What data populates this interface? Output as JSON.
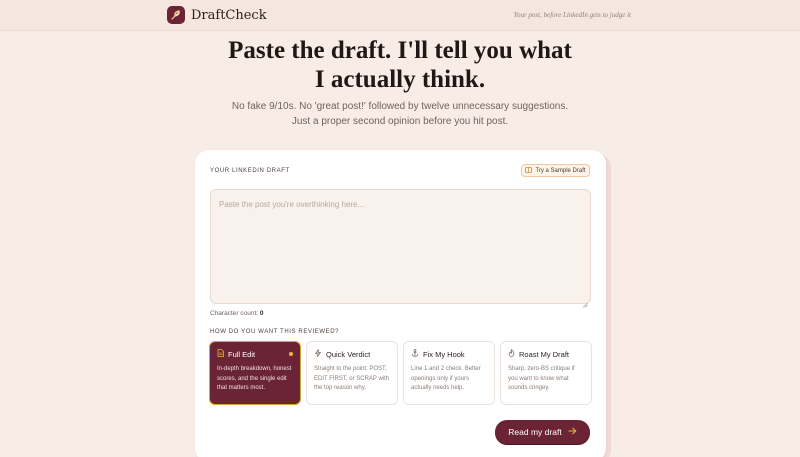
{
  "app": {
    "name": "DraftCheck",
    "tagline": "Your post, before LinkedIn gets to judge it"
  },
  "hero": {
    "title_line1": "Paste the draft. I'll tell you what",
    "title_line2": "I actually think.",
    "sub_line1": "No fake 9/10s. No 'great post!' followed by twelve unnecessary suggestions.",
    "sub_line2": "Just a proper second opinion before you hit post."
  },
  "draft": {
    "section_label": "YOUR LINKEDIN DRAFT",
    "sample_button": "Try a Sample Draft",
    "placeholder": "Paste the post you're overthinking here...",
    "value": "",
    "char_count_label": "Character count:",
    "char_count_value": "0"
  },
  "review": {
    "section_label": "HOW DO YOU WANT THIS REVIEWED?",
    "modes": [
      {
        "title": "Full Edit",
        "desc": "In-depth breakdown, honest scores, and the single edit that matters most.",
        "icon": "document-icon",
        "selected": true
      },
      {
        "title": "Quick Verdict",
        "desc": "Straight to the point: POST, EDIT FIRST, or SCRAP with the top reason why.",
        "icon": "lightning-icon",
        "selected": false
      },
      {
        "title": "Fix My Hook",
        "desc": "Line 1 and 2 check. Better openings only if yours actually needs help.",
        "icon": "anchor-icon",
        "selected": false
      },
      {
        "title": "Roast My Draft",
        "desc": "Sharp, zero-BS critique if you want to know what sounds cringey.",
        "icon": "flame-icon",
        "selected": false
      }
    ]
  },
  "submit": {
    "label": "Read my draft",
    "icon": "arrow-right-icon"
  },
  "colors": {
    "accent": "#6b2436",
    "background": "#f8ede6",
    "highlight": "#e9b53a"
  }
}
